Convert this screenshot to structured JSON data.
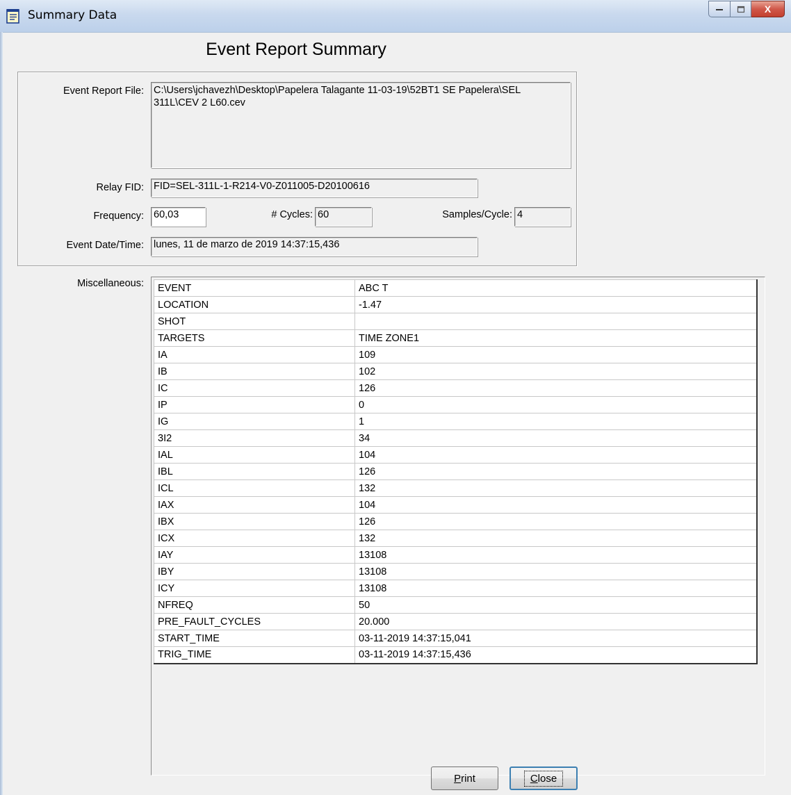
{
  "window": {
    "title": "Summary Data",
    "close_glyph": "X"
  },
  "heading": "Event Report Summary",
  "labels": {
    "event_report_file": "Event Report File:",
    "relay_fid": "Relay FID:",
    "frequency": "Frequency:",
    "cycles": "# Cycles:",
    "samples_cycle": "Samples/Cycle:",
    "event_datetime": "Event Date/Time:",
    "miscellaneous": "Miscellaneous:"
  },
  "values": {
    "event_report_file": "C:\\Users\\jchavezh\\Desktop\\Papelera Talagante 11-03-19\\52BT1 SE Papelera\\SEL 311L\\CEV 2 L60.cev",
    "relay_fid": "FID=SEL-311L-1-R214-V0-Z011005-D20100616",
    "frequency": "60,03",
    "cycles": "60",
    "samples_cycle": "4",
    "event_datetime": "lunes, 11 de marzo de 2019  14:37:15,436"
  },
  "misc_rows": [
    [
      "EVENT",
      "ABC T"
    ],
    [
      "LOCATION",
      "-1.47"
    ],
    [
      "SHOT",
      ""
    ],
    [
      "TARGETS",
      "TIME ZONE1"
    ],
    [
      "IA",
      "109"
    ],
    [
      "IB",
      "102"
    ],
    [
      "IC",
      "126"
    ],
    [
      "IP",
      "0"
    ],
    [
      "IG",
      "1"
    ],
    [
      "3I2",
      "34"
    ],
    [
      "IAL",
      "104"
    ],
    [
      "IBL",
      "126"
    ],
    [
      "ICL",
      "132"
    ],
    [
      "IAX",
      "104"
    ],
    [
      "IBX",
      "126"
    ],
    [
      "ICX",
      "132"
    ],
    [
      "IAY",
      "13108"
    ],
    [
      "IBY",
      "13108"
    ],
    [
      "ICY",
      "13108"
    ],
    [
      "NFREQ",
      "50"
    ],
    [
      "PRE_FAULT_CYCLES",
      "20.000"
    ],
    [
      "START_TIME",
      "03-11-2019 14:37:15,041"
    ],
    [
      "TRIG_TIME",
      "03-11-2019 14:37:15,436"
    ]
  ],
  "buttons": {
    "print_mnemonic": "P",
    "print_rest": "rint",
    "close_mnemonic": "C",
    "close_rest": "lose"
  },
  "icons": {
    "title_icon": "notepad-icon",
    "minimize": "minimize-icon",
    "maximize": "maximize-icon",
    "close": "close-icon"
  }
}
